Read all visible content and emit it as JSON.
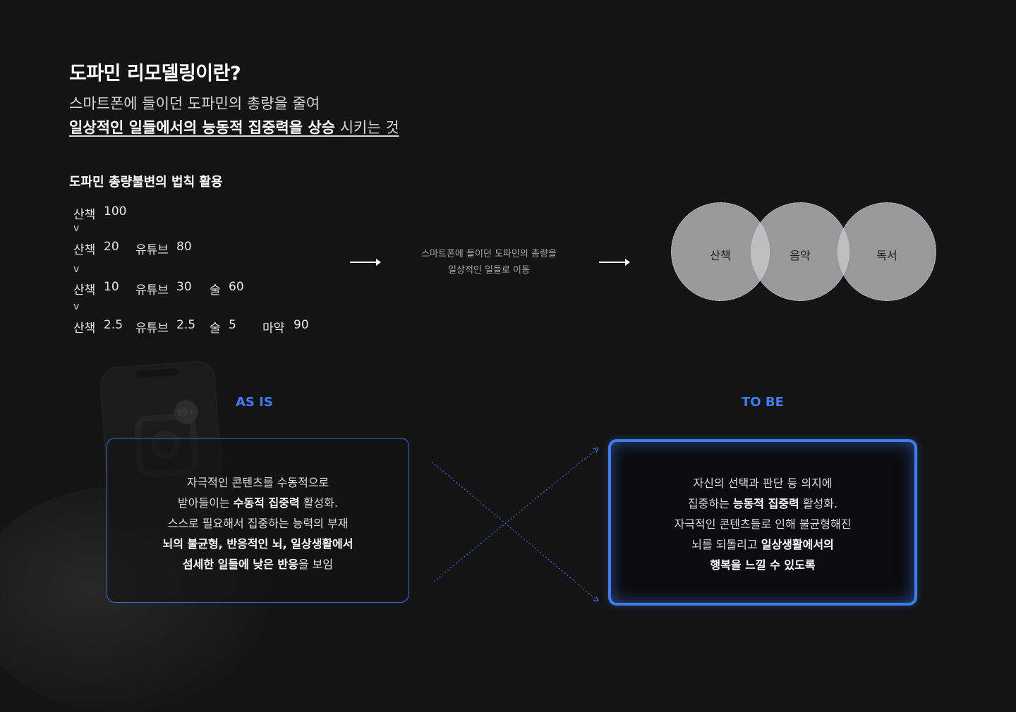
{
  "title": "도파민 리모델링이란?",
  "description": {
    "line1": "스마트폰에 들이던 도파민의 총량을 줄여",
    "line2_bold": "일상적인 일들에서의 능동적 집중력을 상승",
    "line2_rest": " 시키는 것"
  },
  "subtitle": "도파민 총량불변의 법칙 활용",
  "table": {
    "rows": [
      [
        {
          "label": "산책",
          "value": "100"
        }
      ],
      [
        {
          "label": "산책",
          "value": "20"
        },
        {
          "label": "유튜브",
          "value": "80"
        }
      ],
      [
        {
          "label": "산책",
          "value": "10"
        },
        {
          "label": "유튜브",
          "value": "30"
        },
        {
          "label": "술",
          "value": "60"
        }
      ],
      [
        {
          "label": "산책",
          "value": "2.5"
        },
        {
          "label": "유튜브",
          "value": "2.5"
        },
        {
          "label": "술",
          "value": "5"
        },
        {
          "label": "마약",
          "value": "90"
        }
      ]
    ],
    "separator": "v"
  },
  "flow": {
    "line1": "스마트폰에 들이던 도파민의 총량을",
    "line2": "일상적인 일들로 이동"
  },
  "circles": [
    "산책",
    "음악",
    "독서"
  ],
  "phone_badge": "99+",
  "as_is": {
    "heading": "AS IS",
    "lines": [
      [
        {
          "t": "자극적인 콘텐츠를 수동적으로",
          "b": false
        }
      ],
      [
        {
          "t": "받아들이는 ",
          "b": false
        },
        {
          "t": "수동적 집중력",
          "b": true
        },
        {
          "t": " 활성화.",
          "b": false
        }
      ],
      [
        {
          "t": "스스로 필요해서 집중하는 능력의 부재",
          "b": false
        }
      ],
      [
        {
          "t": "뇌의 불균형, 반응적인 뇌, 일상생활에서",
          "b": true
        }
      ],
      [
        {
          "t": "섬세한 일들에 낮은 반응",
          "b": true
        },
        {
          "t": "을 보임",
          "b": false
        }
      ]
    ]
  },
  "to_be": {
    "heading": "TO BE",
    "lines": [
      [
        {
          "t": "자신의 선택과 판단 등 의지에",
          "b": false
        }
      ],
      [
        {
          "t": "집중하는 ",
          "b": false
        },
        {
          "t": "능동적 집중력",
          "b": true
        },
        {
          "t": " 활성화.",
          "b": false
        }
      ],
      [
        {
          "t": "자극적인 콘텐츠들로 인해 불균형해진",
          "b": false
        }
      ],
      [
        {
          "t": "뇌를 되돌리고 ",
          "b": false
        },
        {
          "t": "일상생활에서의",
          "b": true
        }
      ],
      [
        {
          "t": "행복을 느낄 수 있도록",
          "b": true
        }
      ]
    ]
  },
  "colors": {
    "background": "#141414",
    "accent": "#3f7df5",
    "text": "#ffffff",
    "muted": "#a8a8a8"
  }
}
